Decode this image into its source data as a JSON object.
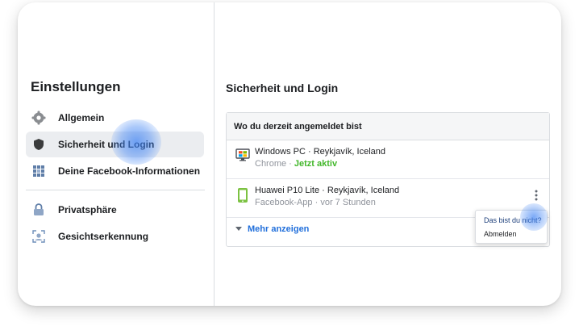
{
  "sidebar": {
    "title": "Einstellungen",
    "items": [
      {
        "label": "Allgemein",
        "icon": "gear-icon"
      },
      {
        "label": "Sicherheit und Login",
        "icon": "shield-icon",
        "active": true
      },
      {
        "label": "Deine Facebook-Informationen",
        "icon": "grid-icon"
      },
      {
        "label": "Privatsphäre",
        "icon": "lock-icon"
      },
      {
        "label": "Gesichtserkennung",
        "icon": "face-scan-icon"
      }
    ]
  },
  "main": {
    "title": "Sicherheit und Login",
    "sessions_header": "Wo du derzeit angemeldet bist",
    "sessions": [
      {
        "device": "Windows PC · Reykjavík, Iceland",
        "app": "Chrome",
        "separator": " · ",
        "status": "Jetzt aktiv",
        "icon": "desktop-icon"
      },
      {
        "device": "Huawei P10 Lite · Reykjavík, Iceland",
        "app": "Facebook-App",
        "separator": " · ",
        "status": "vor 7 Stunden",
        "icon": "phone-icon"
      }
    ],
    "show_more": "Mehr anzeigen",
    "menu": {
      "not_you": "Das bist du nicht?",
      "logout": "Abmelden"
    }
  },
  "colors": {
    "accent": "#216fdb",
    "active_green": "#42b72a",
    "highlight": "#4285f4"
  }
}
